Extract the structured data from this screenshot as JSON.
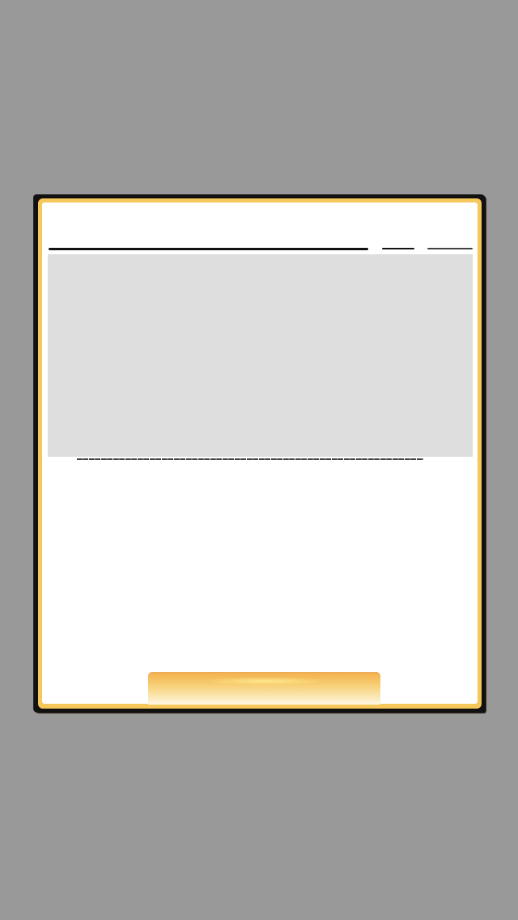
{
  "dialog": {
    "title": "",
    "message": "",
    "action_label": ""
  },
  "colors": {
    "backdrop": "#999999",
    "frame": "#111111",
    "gold_border": "#f6c75a",
    "panel": "#ffffff",
    "content_area": "#dedede",
    "button_top": "#f3b04d",
    "button_bottom": "#fff7e6"
  }
}
